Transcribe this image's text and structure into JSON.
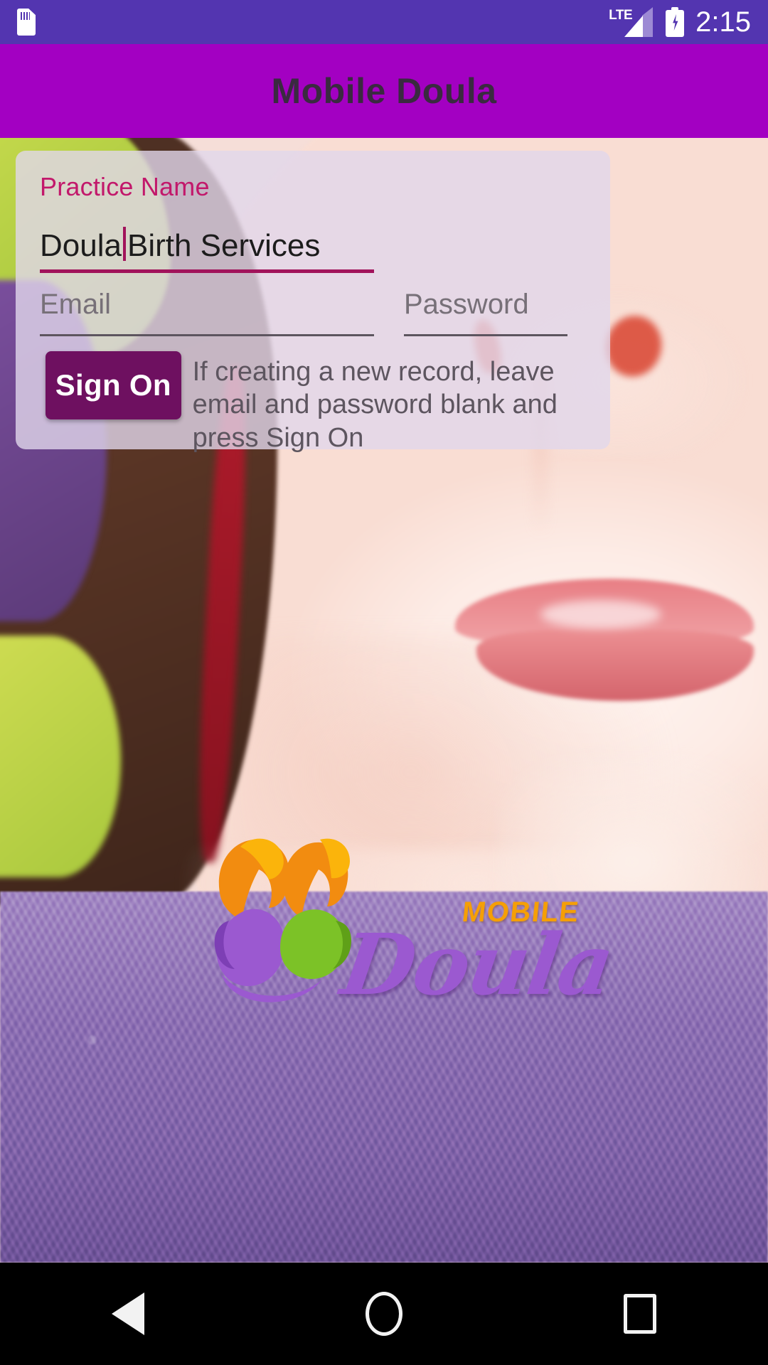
{
  "status_bar": {
    "sd_card_icon": "sd-card-icon",
    "network_label": "LTE",
    "signal_icon": "signal-bars-icon",
    "battery_icon": "battery-charging-icon",
    "time": "2:15",
    "background_color": "#5335b0"
  },
  "app_bar": {
    "title": "Mobile Doula",
    "background_color": "#a300c2",
    "title_color": "#3a2a40"
  },
  "login_card": {
    "practice_name": {
      "label": "Practice Name",
      "value_before_caret": "Doula",
      "value_after_caret": "Birth Services",
      "label_color": "#c2186b",
      "underline_color": "#a1135b"
    },
    "email_field": {
      "placeholder": "Email",
      "value": ""
    },
    "password_field": {
      "placeholder": "Password",
      "value": ""
    },
    "sign_on_button": {
      "label": "Sign On",
      "background_color": "#6e1060",
      "text_color": "#ffffff"
    },
    "hint": "If creating a new record, leave email and password blank and press Sign On",
    "background_color": "rgba(225,215,235,0.80)"
  },
  "logo": {
    "mobile_text": "MOBILE",
    "doula_text": "Doula",
    "mobile_color": "#f59f06",
    "doula_color": "#9b59d0",
    "mark_name": "two-figures-mark"
  },
  "nav_bar": {
    "back_label": "back-icon",
    "home_label": "home-icon",
    "recents_label": "recents-icon",
    "background_color": "#000000"
  }
}
